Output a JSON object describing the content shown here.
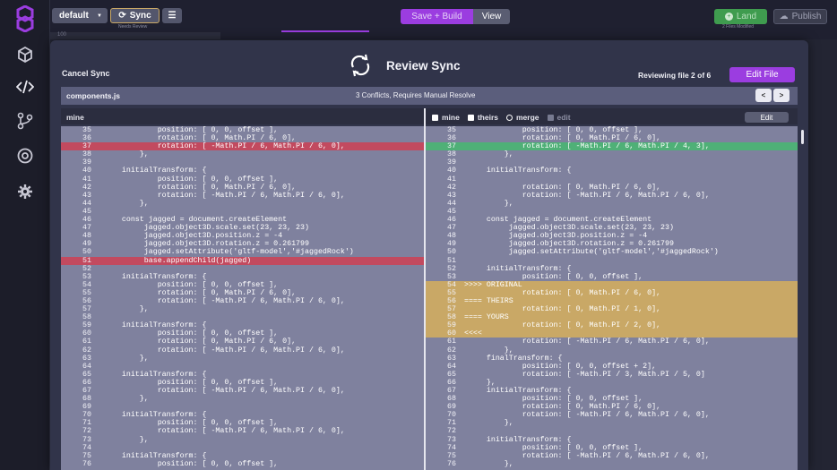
{
  "topbar": {
    "branch": "default",
    "sync_label": "Sync",
    "sync_sub": "Needs Review",
    "save_build_label": "Save + Build",
    "view_label": "View",
    "land_label": "Land",
    "land_sub": "2 Files Modified",
    "publish_label": "Publish",
    "tab_partial": "100"
  },
  "modal": {
    "cancel_label": "Cancel Sync",
    "title": "Review Sync",
    "reviewing": "Reviewing file 2 of 6",
    "edit_file_label": "Edit File",
    "file_name": "components.js",
    "conflicts": "3 Conflicts, Requires Manual Resolve",
    "prev_icon": "chevron-left-icon",
    "next_icon": "chevron-right-icon"
  },
  "left_pane": {
    "header": "mine",
    "lines": [
      {
        "n": "35",
        "t": "              position: [ 0, 0, offset ],",
        "k": ""
      },
      {
        "n": "36",
        "t": "              rotation: [ 0, Math.PI / 6, 0],",
        "k": ""
      },
      {
        "n": "37",
        "t": "              rotation: [ -Math.PI / 6, Math.PI / 6, 0],",
        "k": "del"
      },
      {
        "n": "38",
        "t": "          },",
        "k": ""
      },
      {
        "n": "39",
        "t": "",
        "k": ""
      },
      {
        "n": "40",
        "t": "      initialTransform: {",
        "k": ""
      },
      {
        "n": "41",
        "t": "              position: [ 0, 0, offset ],",
        "k": ""
      },
      {
        "n": "42",
        "t": "              rotation: [ 0, Math.PI / 6, 0],",
        "k": ""
      },
      {
        "n": "43",
        "t": "              rotation: [ -Math.PI / 6, Math.PI / 6, 0],",
        "k": ""
      },
      {
        "n": "44",
        "t": "          },",
        "k": ""
      },
      {
        "n": "45",
        "t": "",
        "k": ""
      },
      {
        "n": "46",
        "t": "      const jagged = document.createElement",
        "k": ""
      },
      {
        "n": "47",
        "t": "           jagged.object3D.scale.set(23, 23, 23)",
        "k": ""
      },
      {
        "n": "48",
        "t": "           jagged.object3D.position.z = -4",
        "k": ""
      },
      {
        "n": "49",
        "t": "           jagged.object3D.rotation.z = 0.261799",
        "k": ""
      },
      {
        "n": "50",
        "t": "           jagged.setAttribute('gltf-model','#jaggedRock')",
        "k": ""
      },
      {
        "n": "51",
        "t": "           base.appendChild(jagged)",
        "k": "del"
      },
      {
        "n": "52",
        "t": "",
        "k": ""
      },
      {
        "n": "53",
        "t": "      initialTransform: {",
        "k": ""
      },
      {
        "n": "54",
        "t": "              position: [ 0, 0, offset ],",
        "k": ""
      },
      {
        "n": "55",
        "t": "              rotation: [ 0, Math.PI / 6, 0],",
        "k": ""
      },
      {
        "n": "56",
        "t": "              rotation: [ -Math.PI / 6, Math.PI / 6, 0],",
        "k": ""
      },
      {
        "n": "57",
        "t": "          },",
        "k": ""
      },
      {
        "n": "58",
        "t": "",
        "k": ""
      },
      {
        "n": "59",
        "t": "      initialTransform: {",
        "k": ""
      },
      {
        "n": "60",
        "t": "              position: [ 0, 0, offset ],",
        "k": ""
      },
      {
        "n": "61",
        "t": "              rotation: [ 0, Math.PI / 6, 0],",
        "k": ""
      },
      {
        "n": "62",
        "t": "              rotation: [ -Math.PI / 6, Math.PI / 6, 0],",
        "k": ""
      },
      {
        "n": "63",
        "t": "          },",
        "k": ""
      },
      {
        "n": "64",
        "t": "",
        "k": ""
      },
      {
        "n": "65",
        "t": "      initialTransform: {",
        "k": ""
      },
      {
        "n": "66",
        "t": "              position: [ 0, 0, offset ],",
        "k": ""
      },
      {
        "n": "67",
        "t": "              rotation: [ -Math.PI / 6, Math.PI / 6, 0],",
        "k": ""
      },
      {
        "n": "68",
        "t": "          },",
        "k": ""
      },
      {
        "n": "69",
        "t": "",
        "k": ""
      },
      {
        "n": "70",
        "t": "      initialTransform: {",
        "k": ""
      },
      {
        "n": "71",
        "t": "              position: [ 0, 0, offset ],",
        "k": ""
      },
      {
        "n": "72",
        "t": "              rotation: [ -Math.PI / 6, Math.PI / 6, 0],",
        "k": ""
      },
      {
        "n": "73",
        "t": "          },",
        "k": ""
      },
      {
        "n": "74",
        "t": "",
        "k": ""
      },
      {
        "n": "75",
        "t": "      initialTransform: {",
        "k": ""
      },
      {
        "n": "76",
        "t": "              position: [ 0, 0, offset ],",
        "k": ""
      }
    ]
  },
  "right_pane": {
    "options": [
      {
        "label": "mine",
        "style": "box"
      },
      {
        "label": "theirs",
        "style": "box"
      },
      {
        "label": "merge",
        "style": "round"
      },
      {
        "label": "edit",
        "style": "dim"
      }
    ],
    "edit_label": "Edit",
    "lines": [
      {
        "n": "35",
        "t": "              position: [ 0, 0, offset ],",
        "k": ""
      },
      {
        "n": "36",
        "t": "              rotation: [ 0, Math.PI / 6, 0],",
        "k": ""
      },
      {
        "n": "37",
        "t": "              rotation: [ -Math.PI / 6, Math.PI / 4, 3],",
        "k": "add"
      },
      {
        "n": "38",
        "t": "          },",
        "k": ""
      },
      {
        "n": "39",
        "t": "",
        "k": ""
      },
      {
        "n": "40",
        "t": "      initialTransform: {",
        "k": ""
      },
      {
        "n": "41",
        "t": "",
        "k": ""
      },
      {
        "n": "42",
        "t": "              rotation: [ 0, Math.PI / 6, 0],",
        "k": ""
      },
      {
        "n": "43",
        "t": "              rotation: [ -Math.PI / 6, Math.PI / 6, 0],",
        "k": ""
      },
      {
        "n": "44",
        "t": "          },",
        "k": ""
      },
      {
        "n": "45",
        "t": "",
        "k": ""
      },
      {
        "n": "46",
        "t": "      const jagged = document.createElement",
        "k": ""
      },
      {
        "n": "47",
        "t": "           jagged.object3D.scale.set(23, 23, 23)",
        "k": ""
      },
      {
        "n": "48",
        "t": "           jagged.object3D.position.z = -4",
        "k": ""
      },
      {
        "n": "49",
        "t": "           jagged.object3D.rotation.z = 0.261799",
        "k": ""
      },
      {
        "n": "50",
        "t": "           jagged.setAttribute('gltf-model','#jaggedRock')",
        "k": ""
      },
      {
        "n": "51",
        "t": "",
        "k": ""
      },
      {
        "n": "52",
        "t": "      initialTransform: {",
        "k": ""
      },
      {
        "n": "53",
        "t": "              position: [ 0, 0, offset ],",
        "k": ""
      },
      {
        "n": "54",
        "t": " >>>> ORIGINAL",
        "k": "conf"
      },
      {
        "n": "55",
        "t": "              rotation: [ 0, Math.PI / 6, 0],",
        "k": "conf"
      },
      {
        "n": "56",
        "t": " ==== THEIRS",
        "k": "conf"
      },
      {
        "n": "57",
        "t": "              rotation: [ 0, Math.PI / 1, 0],",
        "k": "conf"
      },
      {
        "n": "58",
        "t": " ==== YOURS",
        "k": "conf"
      },
      {
        "n": "59",
        "t": "              rotation: [ 0, Math.PI / 2, 0],",
        "k": "conf"
      },
      {
        "n": "60",
        "t": " <<<<",
        "k": "conf"
      },
      {
        "n": "61",
        "t": "              rotation: [ -Math.PI / 6, Math.PI / 6, 0],",
        "k": ""
      },
      {
        "n": "62",
        "t": "          },",
        "k": ""
      },
      {
        "n": "63",
        "t": "      finalTransform: {",
        "k": ""
      },
      {
        "n": "64",
        "t": "              position: [ 0, 0, offset + 2],",
        "k": ""
      },
      {
        "n": "65",
        "t": "              rotation: [ -Math.PI / 3, Math.PI / 5, 0]",
        "k": ""
      },
      {
        "n": "66",
        "t": "      },",
        "k": ""
      },
      {
        "n": "67",
        "t": "      initialTransform: {",
        "k": ""
      },
      {
        "n": "68",
        "t": "              position: [ 0, 0, offset ],",
        "k": ""
      },
      {
        "n": "69",
        "t": "              rotation: [ 0, Math.PI / 6, 0],",
        "k": ""
      },
      {
        "n": "70",
        "t": "              rotation: [ -Math.PI / 6, Math.PI / 6, 0],",
        "k": ""
      },
      {
        "n": "71",
        "t": "          },",
        "k": ""
      },
      {
        "n": "72",
        "t": "",
        "k": ""
      },
      {
        "n": "73",
        "t": "      initialTransform: {",
        "k": ""
      },
      {
        "n": "74",
        "t": "              position: [ 0, 0, offset ],",
        "k": ""
      },
      {
        "n": "75",
        "t": "              rotation: [ -Math.PI / 6, Math.PI / 6, 0],",
        "k": ""
      },
      {
        "n": "76",
        "t": "          },",
        "k": ""
      }
    ]
  },
  "colors": {
    "accent": "#9b3de0",
    "deleted_line": "#c24a5f",
    "added_line": "#4fb077",
    "conflict_block": "#c9a866",
    "land_green": "#3f9c4f"
  },
  "rail_icons": [
    "logo-icon",
    "cube-icon",
    "code-icon",
    "branch-icon",
    "target-icon",
    "gear-icon"
  ]
}
